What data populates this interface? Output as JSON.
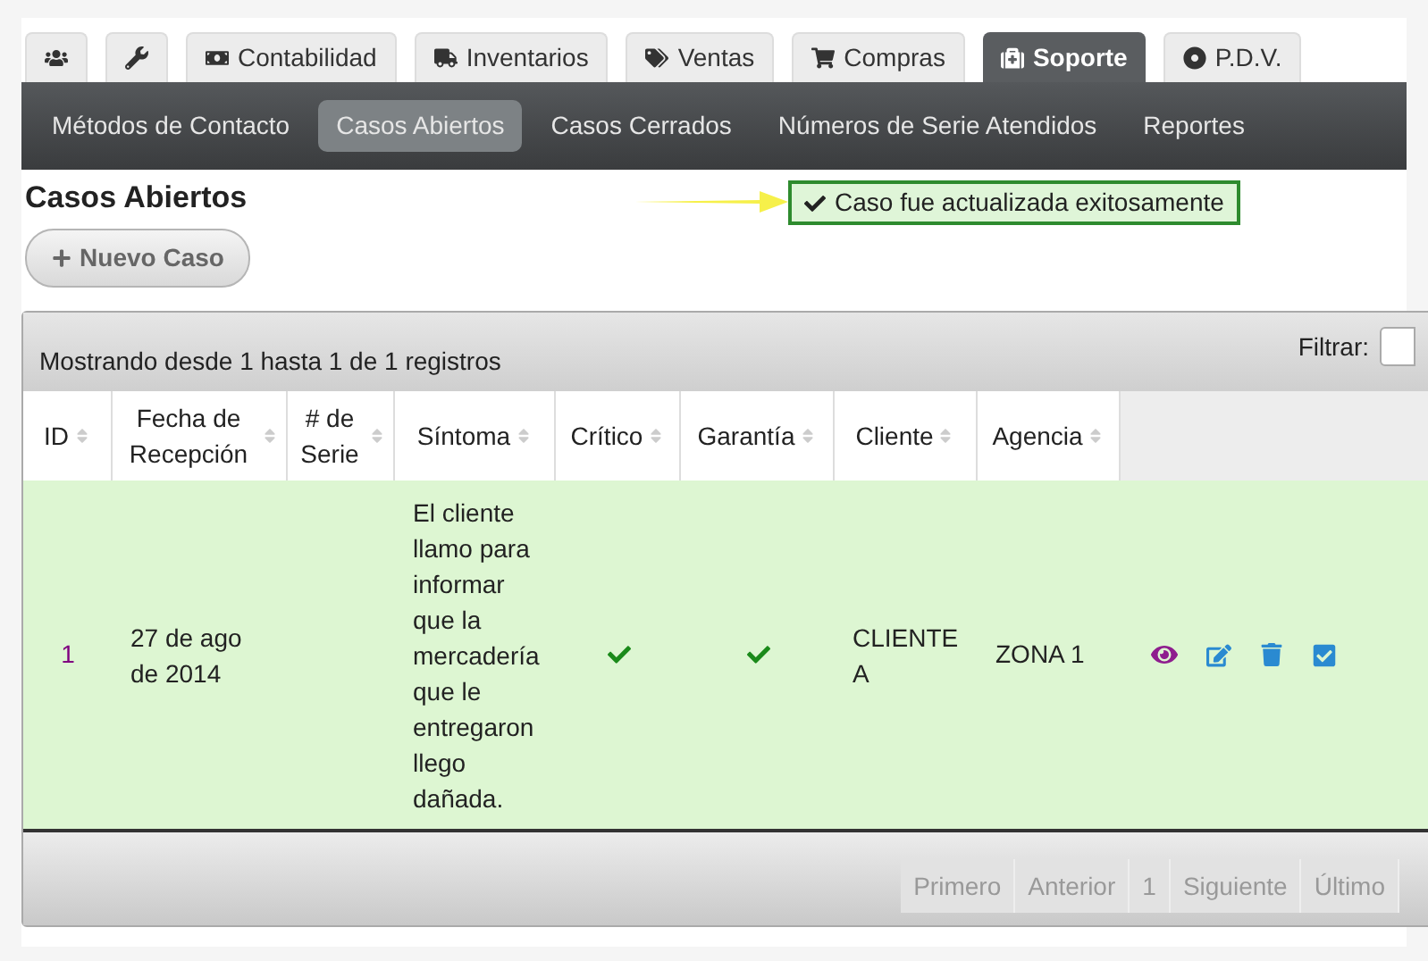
{
  "tabs": [
    {
      "selected": false
    },
    {
      "selected": false
    },
    {
      "label": "Contabilidad",
      "selected": false
    },
    {
      "label": "Inventarios",
      "selected": false
    },
    {
      "label": "Ventas",
      "selected": false
    },
    {
      "label": "Compras",
      "selected": false
    },
    {
      "label": "Soporte",
      "selected": true
    },
    {
      "label": "P.D.V.",
      "selected": false
    }
  ],
  "subnav": [
    {
      "label": "Métodos de Contacto",
      "selected": false
    },
    {
      "label": "Casos Abiertos",
      "selected": true
    },
    {
      "label": "Casos Cerrados",
      "selected": false
    },
    {
      "label": "Números de Serie Atendidos",
      "selected": false
    },
    {
      "label": "Reportes",
      "selected": false
    }
  ],
  "page_title": "Casos Abiertos",
  "alert": "Caso fue actualizada exitosamente",
  "new_button": "Nuevo Caso",
  "info": "Mostrando desde 1 hasta 1 de 1 registros",
  "filter_label": "Filtrar:",
  "table": {
    "columns": [
      "ID",
      "Fecha de Recepción",
      "# de Serie",
      "Síntoma",
      "Crítico",
      "Garantía",
      "Cliente",
      "Agencia"
    ],
    "rows": [
      {
        "id": "1",
        "date": "27 de ago de 2014",
        "serial": "",
        "symptom": "El cliente llamo para informar que la mercadería que le entregaron llego dañada.",
        "critical": true,
        "warranty": true,
        "client": "CLIENTE A",
        "agency": "ZONA 1"
      }
    ]
  },
  "pagination": [
    "Primero",
    "Anterior",
    "1",
    "Siguiente",
    "Último"
  ]
}
